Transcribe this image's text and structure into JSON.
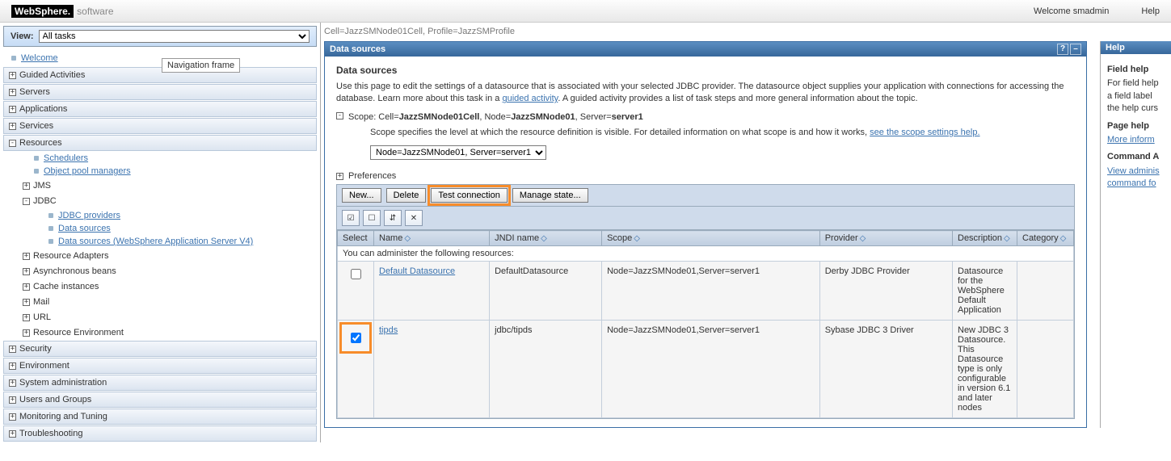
{
  "top": {
    "logo_main": "WebSphere.",
    "logo_sub": "software",
    "welcome": "Welcome smadmin",
    "help": "Help"
  },
  "sidebar": {
    "view_label": "View:",
    "view_value": "All tasks",
    "nav_tip": "Navigation frame",
    "welcome": "Welcome",
    "sections": {
      "guided": "Guided Activities",
      "servers": "Servers",
      "applications": "Applications",
      "services": "Services",
      "resources": "Resources",
      "security": "Security",
      "environment": "Environment",
      "sysadmin": "System administration",
      "users": "Users and Groups",
      "monitoring": "Monitoring and Tuning",
      "troubleshooting": "Troubleshooting"
    },
    "resources_children": {
      "schedulers": "Schedulers",
      "opm": "Object pool managers",
      "jms": "JMS",
      "jdbc": "JDBC",
      "jdbc_providers": "JDBC providers",
      "data_sources": "Data sources",
      "ds_v4": "Data sources (WebSphere Application Server V4)",
      "ra": "Resource Adapters",
      "async": "Asynchronous beans",
      "cache": "Cache instances",
      "mail": "Mail",
      "url": "URL",
      "renv": "Resource Environment"
    }
  },
  "breadcrumb": "Cell=JazzSMNode01Cell, Profile=JazzSMProfile",
  "portlet": {
    "title": "Data sources",
    "heading": "Data sources",
    "desc1": "Use this page to edit the settings of a datasource that is associated with your selected JDBC provider. The datasource object supplies your application with connections for accessing the database. Learn more about this task in a ",
    "desc_link": "guided activity",
    "desc2": ". A guided activity provides a list of task steps and more general information about the topic.",
    "scope_label": "Scope: Cell=",
    "scope_cell": "JazzSMNode01Cell",
    "scope_node_lbl": ", Node=",
    "scope_node": "JazzSMNode01",
    "scope_srv_lbl": ", Server=",
    "scope_srv": "server1",
    "scope_desc": "Scope specifies the level at which the resource definition is visible. For detailed information on what scope is and how it works, ",
    "scope_help_link": "see the scope settings help.",
    "scope_select": "Node=JazzSMNode01, Server=server1",
    "prefs": "Preferences"
  },
  "buttons": {
    "new": "New...",
    "delete": "Delete",
    "test": "Test connection",
    "manage": "Manage state..."
  },
  "table": {
    "h_select": "Select",
    "h_name": "Name",
    "h_jndi": "JNDI name",
    "h_scope": "Scope",
    "h_provider": "Provider",
    "h_desc": "Description",
    "h_cat": "Category",
    "admin_note": "You can administer the following resources:",
    "rows": [
      {
        "checked": false,
        "name": "Default Datasource",
        "jndi": "DefaultDatasource",
        "scope": "Node=JazzSMNode01,Server=server1",
        "provider": "Derby JDBC Provider",
        "desc": "Datasource for the WebSphere Default Application",
        "cat": ""
      },
      {
        "checked": true,
        "name": "tipds",
        "jndi": "jdbc/tipds",
        "scope": "Node=JazzSMNode01,Server=server1",
        "provider": "Sybase JDBC 3 Driver",
        "desc": "New JDBC 3 Datasource. This Datasource type is only configurable in version 6.1 and later nodes",
        "cat": ""
      }
    ]
  },
  "help": {
    "title": "Help",
    "field_h": "Field help",
    "field_t": "For field help a field label the help curs",
    "page_h": "Page help",
    "page_link": "More inform",
    "cmd_h": "Command A",
    "cmd_link1": "View adminis",
    "cmd_link2": "command fo"
  }
}
